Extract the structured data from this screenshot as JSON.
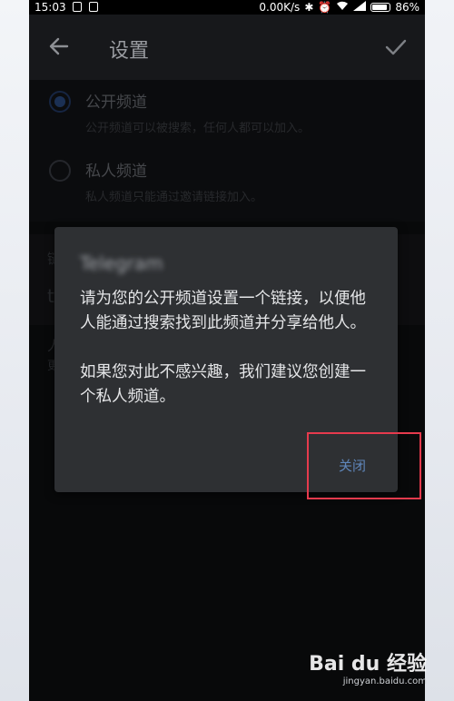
{
  "status_bar": {
    "time": "15:03",
    "network_speed": "0.00K/s",
    "battery": "86%"
  },
  "toolbar": {
    "title": "设置"
  },
  "options": [
    {
      "title": "公开频道",
      "subtitle": "公开频道可以被搜索，任何人都可以加入。",
      "selected": true
    },
    {
      "title": "私人频道",
      "subtitle": "私人频道只能通过邀请链接加入。",
      "selected": false
    }
  ],
  "background_fragments": {
    "a": "链",
    "b": "t",
    "c": "人",
    "d": "更"
  },
  "dialog": {
    "title": "Telegram",
    "message_1": "请为您的公开频道设置一个链接，以便他人能通过搜索找到此频道并分享给他人。",
    "message_2": "如果您对此不感兴趣，我们建议您创建一个私人频道。",
    "close_label": "关闭"
  },
  "watermark": {
    "logo": "Bai du 经验",
    "url": "jingyan.baidu.com"
  },
  "colors": {
    "accent": "#5f86ba",
    "highlight": "#e63a4d",
    "dialog_bg": "#2e3033"
  }
}
